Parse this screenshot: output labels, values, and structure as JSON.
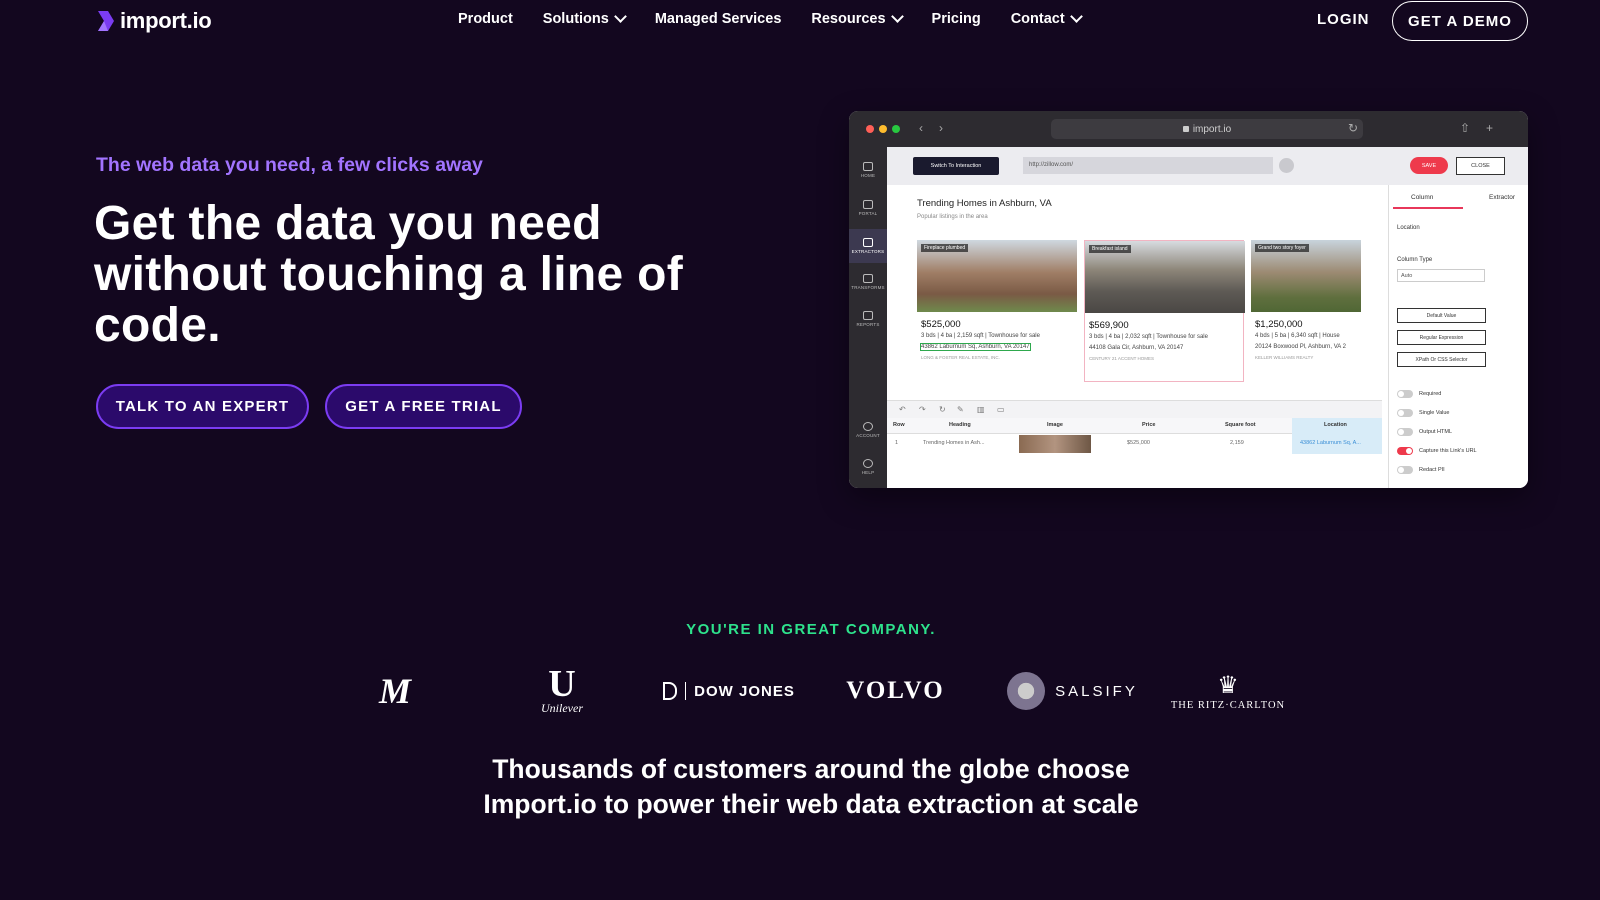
{
  "nav": {
    "logo_text": "import.io",
    "items": [
      {
        "label": "Product",
        "dropdown": false
      },
      {
        "label": "Solutions",
        "dropdown": true
      },
      {
        "label": "Managed Services",
        "dropdown": false
      },
      {
        "label": "Resources",
        "dropdown": true
      },
      {
        "label": "Pricing",
        "dropdown": false
      },
      {
        "label": "Contact",
        "dropdown": true
      }
    ],
    "login_label": "LOGIN",
    "demo_label": "GET A DEMO"
  },
  "hero": {
    "eyebrow": "The web data you need, a few clicks away",
    "title": "Get the data you need without touching a line of code.",
    "expert_label": "TALK TO AN EXPERT",
    "trial_label": "GET A FREE TRIAL"
  },
  "app": {
    "browser_url": "import.io",
    "sidebar": [
      "HOME",
      "PORTAL",
      "EXTRACTORS",
      "TRANSFORMS",
      "REPORTS",
      "ACCOUNT",
      "HELP"
    ],
    "switch_label": "Switch To Interaction",
    "url_field": "http://zillow.com/",
    "save_label": "SAVE",
    "close_label": "CLOSE",
    "page_title": "Trending Homes in Ashburn, VA",
    "page_sub": "Popular listings in the area",
    "cards": [
      {
        "tag": "Fireplace plumbed",
        "price": "$525,000",
        "l1": "3 bds | 4 ba | 2,159 sqft | Townhouse for sale",
        "l2": "43862 Laburnum Sq, Ashburn, VA 20147",
        "l3": "LONG & FOSTER REAL ESTATE, INC."
      },
      {
        "tag": "Breakfast island",
        "price": "$569,900",
        "l1": "3 bds | 4 ba | 2,032 sqft | Townhouse for sale",
        "l2": "44108 Gala Cir, Ashburn, VA 20147",
        "l3": "CENTURY 21 ACCENT HOMES"
      },
      {
        "tag": "Grand two story foyer",
        "price": "$1,250,000",
        "l1": "4 bds | 5 ba | 6,340 sqft | House",
        "l2": "20124 Boxwood Pl, Ashburn, VA 2",
        "l3": "KELLER WILLIAMS REALTY"
      }
    ],
    "table_headers": [
      "Row",
      "Heading",
      "Image",
      "Price",
      "Square foot",
      "Location"
    ],
    "table_row": {
      "row": "1",
      "heading": "Trending Homes in Ash...",
      "price": "$525,000",
      "sqft": "2,159",
      "location": "43862 Laburnum Sq, A..."
    },
    "panel": {
      "tab_column": "Column",
      "tab_extractor": "Extractor",
      "field_label": "Location",
      "type_label": "Column Type",
      "type_value": "Auto",
      "buttons": [
        "Default Value",
        "Regular Expression",
        "XPath Or CSS Selector"
      ],
      "toggles": [
        {
          "label": "Required",
          "on": false
        },
        {
          "label": "Single Value",
          "on": false
        },
        {
          "label": "Output HTML",
          "on": false
        },
        {
          "label": "Capture this Link's URL",
          "on": true
        },
        {
          "label": "Redact PII",
          "on": false
        }
      ]
    }
  },
  "logos": {
    "heading": "YOU'RE IN GREAT COMPANY.",
    "m": "M",
    "unilever_mark": "U",
    "unilever_text": "Unilever",
    "dowjones": "DOW JONES",
    "volvo": "VOLVO",
    "salsify": "SALSIFY",
    "ritz": "THE RITZ·CARLTON"
  },
  "bottom": {
    "line1": "Thousands of customers around the globe choose",
    "line2": "Import.io to power their web data extraction at scale"
  },
  "colors": {
    "background": "#13071f",
    "accent_purple": "#a274ff",
    "button_fill": "#2b0a6b",
    "button_border": "#7b3cf2",
    "company_green": "#2ee28c"
  }
}
